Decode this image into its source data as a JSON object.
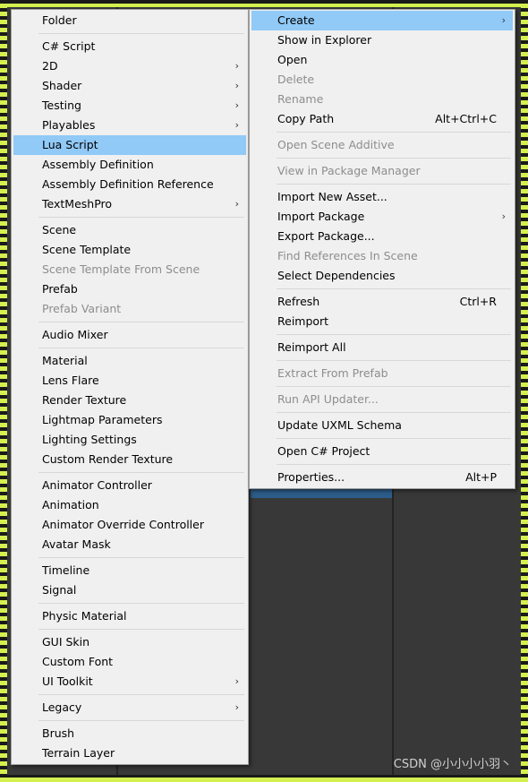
{
  "left_menu": {
    "items": [
      {
        "label": "Folder"
      },
      {
        "sep": true
      },
      {
        "label": "C# Script"
      },
      {
        "label": "2D",
        "sub": true
      },
      {
        "label": "Shader",
        "sub": true
      },
      {
        "label": "Testing",
        "sub": true
      },
      {
        "label": "Playables",
        "sub": true
      },
      {
        "label": "Lua Script",
        "highlighted": true
      },
      {
        "label": "Assembly Definition"
      },
      {
        "label": "Assembly Definition Reference"
      },
      {
        "label": "TextMeshPro",
        "sub": true
      },
      {
        "sep": true
      },
      {
        "label": "Scene"
      },
      {
        "label": "Scene Template"
      },
      {
        "label": "Scene Template From Scene",
        "disabled": true
      },
      {
        "label": "Prefab"
      },
      {
        "label": "Prefab Variant",
        "disabled": true
      },
      {
        "sep": true
      },
      {
        "label": "Audio Mixer"
      },
      {
        "sep": true
      },
      {
        "label": "Material"
      },
      {
        "label": "Lens Flare"
      },
      {
        "label": "Render Texture"
      },
      {
        "label": "Lightmap Parameters"
      },
      {
        "label": "Lighting Settings"
      },
      {
        "label": "Custom Render Texture"
      },
      {
        "sep": true
      },
      {
        "label": "Animator Controller"
      },
      {
        "label": "Animation"
      },
      {
        "label": "Animator Override Controller"
      },
      {
        "label": "Avatar Mask"
      },
      {
        "sep": true
      },
      {
        "label": "Timeline"
      },
      {
        "label": "Signal"
      },
      {
        "sep": true
      },
      {
        "label": "Physic Material"
      },
      {
        "sep": true
      },
      {
        "label": "GUI Skin"
      },
      {
        "label": "Custom Font"
      },
      {
        "label": "UI Toolkit",
        "sub": true
      },
      {
        "sep": true
      },
      {
        "label": "Legacy",
        "sub": true
      },
      {
        "sep": true
      },
      {
        "label": "Brush"
      },
      {
        "label": "Terrain Layer"
      }
    ]
  },
  "right_menu": {
    "items": [
      {
        "label": "Create",
        "sub": true,
        "highlighted": true
      },
      {
        "label": "Show in Explorer"
      },
      {
        "label": "Open"
      },
      {
        "label": "Delete",
        "disabled": true
      },
      {
        "label": "Rename",
        "disabled": true
      },
      {
        "label": "Copy Path",
        "shortcut": "Alt+Ctrl+C"
      },
      {
        "sep": true
      },
      {
        "label": "Open Scene Additive",
        "disabled": true
      },
      {
        "sep": true
      },
      {
        "label": "View in Package Manager",
        "disabled": true
      },
      {
        "sep": true
      },
      {
        "label": "Import New Asset..."
      },
      {
        "label": "Import Package",
        "sub": true
      },
      {
        "label": "Export Package..."
      },
      {
        "label": "Find References In Scene",
        "disabled": true
      },
      {
        "label": "Select Dependencies"
      },
      {
        "sep": true
      },
      {
        "label": "Refresh",
        "shortcut": "Ctrl+R"
      },
      {
        "label": "Reimport"
      },
      {
        "sep": true
      },
      {
        "label": "Reimport All"
      },
      {
        "sep": true
      },
      {
        "label": "Extract From Prefab",
        "disabled": true
      },
      {
        "sep": true
      },
      {
        "label": "Run API Updater...",
        "disabled": true
      },
      {
        "sep": true
      },
      {
        "label": "Update UXML Schema"
      },
      {
        "sep": true
      },
      {
        "label": "Open C# Project"
      },
      {
        "sep": true
      },
      {
        "label": "Properties...",
        "shortcut": "Alt+P"
      }
    ]
  },
  "watermark": "CSDN @小小小小羽丶",
  "colors": {
    "highlight": "#91c9f7",
    "background": "#383838",
    "disabled": "#8d8d8d"
  }
}
